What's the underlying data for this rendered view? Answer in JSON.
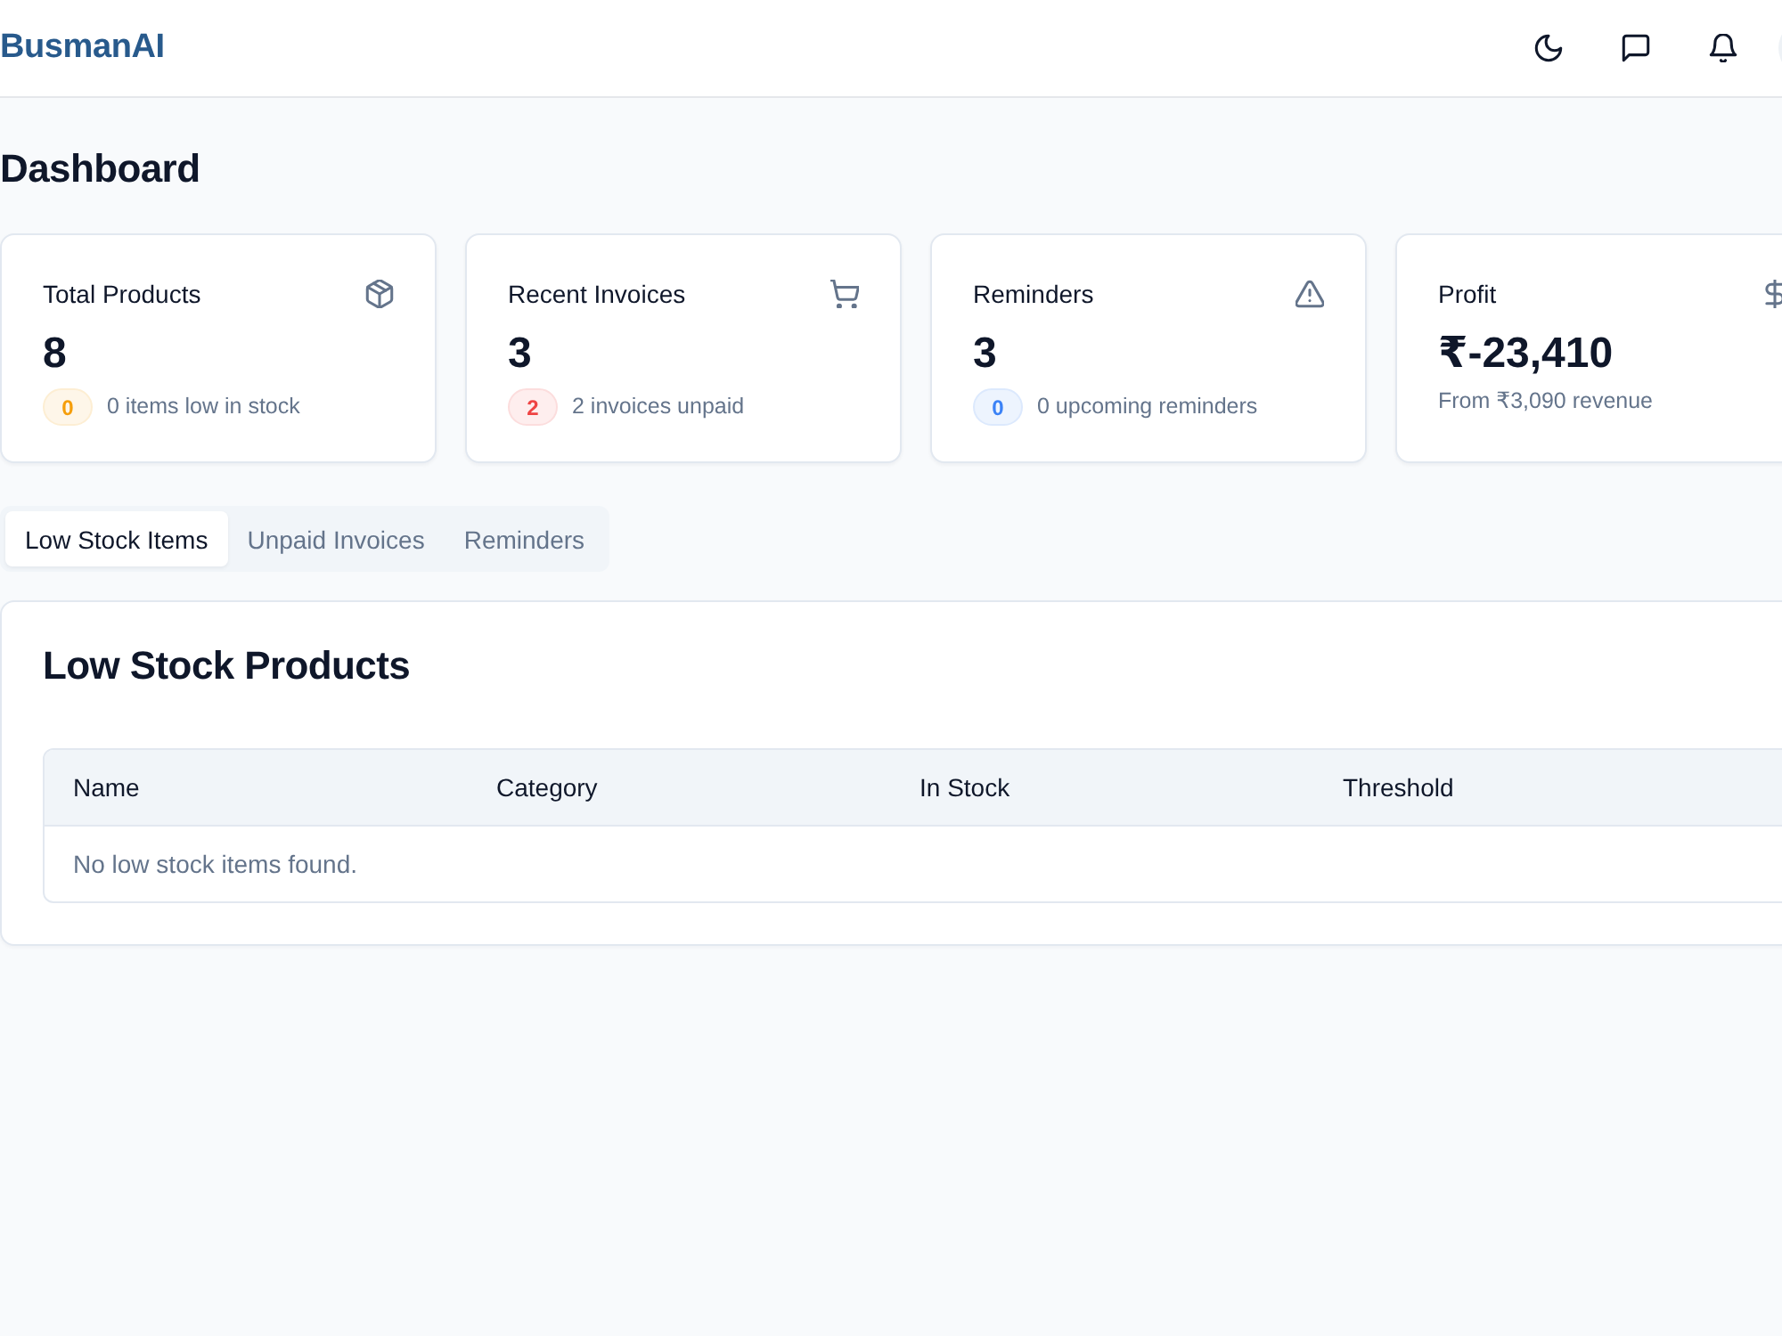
{
  "header": {
    "logo": "BusmanAI"
  },
  "page": {
    "title": "Dashboard"
  },
  "stats": [
    {
      "title": "Total Products",
      "value": "8",
      "badge": {
        "text": "0",
        "color": "#f59e0b"
      },
      "note": "0 items low in stock"
    },
    {
      "title": "Recent Invoices",
      "value": "3",
      "badge": {
        "text": "2",
        "color": "#ef4444"
      },
      "note": "2 invoices unpaid"
    },
    {
      "title": "Reminders",
      "value": "3",
      "badge": {
        "text": "0",
        "color": "#3b82f6"
      },
      "note": "0 upcoming reminders"
    },
    {
      "title": "Profit",
      "value": "₹-23,410",
      "note": "From ₹3,090 revenue"
    }
  ],
  "tabs": [
    {
      "label": "Low Stock Items",
      "selected": true
    },
    {
      "label": "Unpaid Invoices",
      "selected": false
    },
    {
      "label": "Reminders",
      "selected": false
    }
  ],
  "panel": {
    "title": "Low Stock Products",
    "table": {
      "columns": [
        "Name",
        "Category",
        "In Stock",
        "Threshold"
      ],
      "empty_message": "No low stock items found."
    }
  }
}
